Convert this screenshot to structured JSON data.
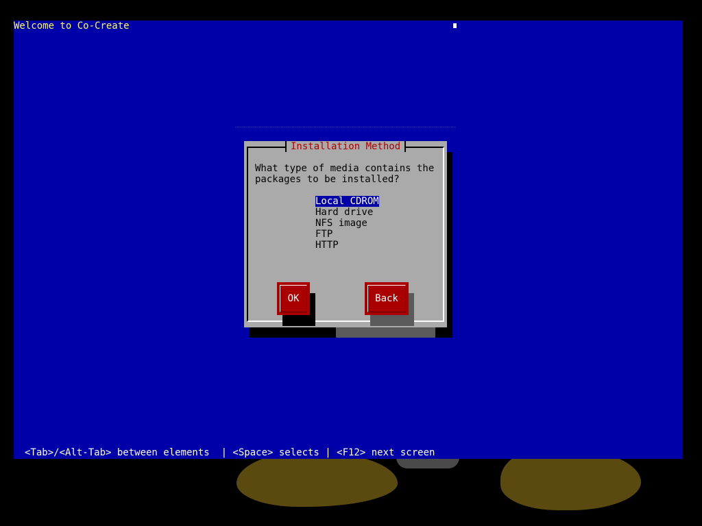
{
  "screen": {
    "title": "Welcome to Co-Create",
    "help": "<Tab>/<Alt-Tab> between elements  | <Space> selects | <F12> next screen"
  },
  "dialog": {
    "title": "Installation Method",
    "prompt": "What type of media contains the\npackages to be installed?",
    "methods": [
      "Local CDROM",
      "Hard drive",
      "NFS image",
      "FTP",
      "HTTP"
    ],
    "selected_method": "Local CDROM",
    "ok_label": "OK",
    "back_label": "Back"
  },
  "colors": {
    "screen_bg": "#0000a8",
    "title_text": "#ffff55",
    "dialog_bg": "#aaaaaa",
    "dialog_title": "#aa0000",
    "button_bg": "#aa0000",
    "selection_bg": "#0000a8"
  }
}
